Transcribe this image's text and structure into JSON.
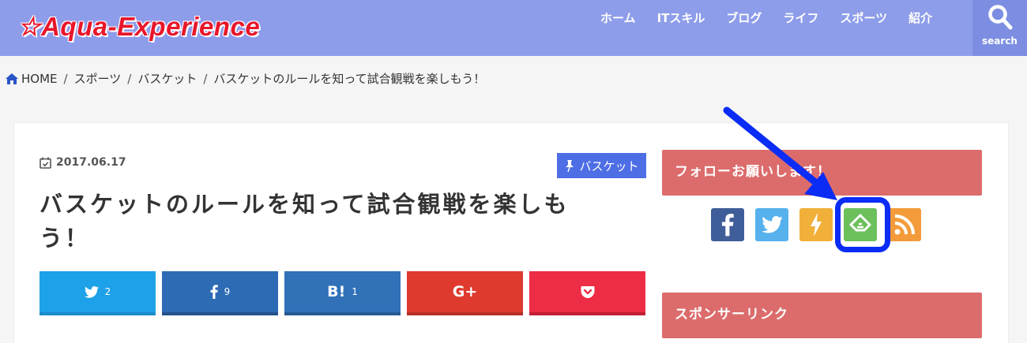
{
  "header": {
    "logo": "☆Aqua-Experience",
    "nav": [
      "ホーム",
      "ITスキル",
      "ブログ",
      "ライフ",
      "スポーツ",
      "紹介"
    ],
    "search_label": "search"
  },
  "breadcrumb": {
    "items": [
      "HOME",
      "スポーツ",
      "バスケット",
      "バスケットのルールを知って試合観戦を楽しもう！"
    ],
    "separator": "/"
  },
  "article": {
    "date": "2017.06.17",
    "category": "バスケット",
    "title": "バスケットのルールを知って試合観戦を楽しもう！",
    "share": [
      {
        "id": "twitter",
        "icon": "twitter-icon",
        "count": "2"
      },
      {
        "id": "facebook",
        "icon": "facebook-icon",
        "count": "9"
      },
      {
        "id": "hatena",
        "icon": "hatena-bookmark-icon",
        "label": "B!",
        "count": "1"
      },
      {
        "id": "google",
        "icon": "google-plus-icon",
        "label": "G+",
        "count": ""
      },
      {
        "id": "pocket",
        "icon": "pocket-icon",
        "count": ""
      }
    ]
  },
  "sidebar": {
    "follow_title": "フォローお願いします！",
    "follow_icons": [
      "facebook-icon",
      "twitter-icon",
      "push7-icon",
      "feedly-icon",
      "rss-icon"
    ],
    "sponsor_title": "スポンサーリンク"
  },
  "colors": {
    "header": "#8e9de9",
    "logo": "#e8162a",
    "widget_title": "#dc6c6c",
    "category_badge": "#4e6ee6",
    "highlight": "#0b2cf5"
  }
}
